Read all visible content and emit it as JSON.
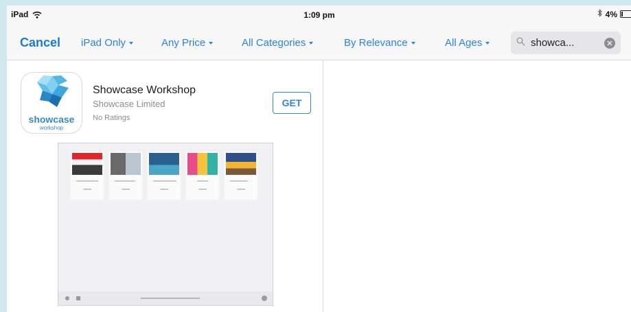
{
  "status_bar": {
    "device": "iPad",
    "time": "1:09 pm",
    "battery": "4%"
  },
  "toolbar": {
    "cancel_label": "Cancel",
    "filters": [
      {
        "label": "iPad Only"
      },
      {
        "label": "Any Price"
      },
      {
        "label": "All Categories"
      },
      {
        "label": "By Relevance"
      },
      {
        "label": "All Ages"
      }
    ],
    "search_query": "showca..."
  },
  "result": {
    "app_name": "Showcase Workshop",
    "developer": "Showcase Limited",
    "rating_text": "No Ratings",
    "get_label": "GET",
    "icon": {
      "name": "showcase-app-icon",
      "wordmark": "showcase",
      "wordmark_sub": "workshop"
    }
  },
  "colors": {
    "accent": "#2b83e0",
    "cancel": "#1a7ad8",
    "background_border": "#cfe7ee",
    "toolbar_bg": "#f7f7f8"
  }
}
